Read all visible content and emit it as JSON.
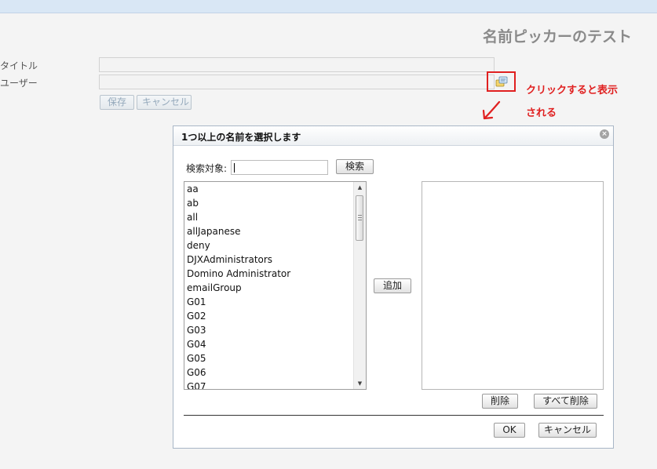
{
  "page": {
    "title": "名前ピッカーのテスト",
    "fields": {
      "title_label": "タイトル",
      "user_label": "ユーザー",
      "title_value": "",
      "user_value": ""
    },
    "buttons": {
      "save": "保存",
      "cancel": "キャンセル"
    },
    "annotation": {
      "line1": "クリックすると表示",
      "line2": "される"
    }
  },
  "dialog": {
    "title": "1つ以上の名前を選択します",
    "close_glyph": "×",
    "search_label": "検索対象:",
    "search_value": "",
    "search_button": "検索",
    "add_button": "追加",
    "delete_button": "削除",
    "delete_all_button": "すべて削除",
    "ok_button": "OK",
    "cancel_button": "キャンセル",
    "names": [
      "aa",
      "ab",
      "all",
      "allJapanese",
      "deny",
      "DJXAdministrators",
      "Domino Administrator",
      "emailGroup",
      "G01",
      "G02",
      "G03",
      "G04",
      "G05",
      "G06",
      "G07"
    ],
    "selected": []
  },
  "icons": {
    "picker": "address-book-icon",
    "close": "close-icon",
    "arrow": "hand-drawn-arrow-icon",
    "scroll_up": "scroll-up-arrow-icon",
    "scroll_down": "scroll-down-arrow-icon"
  },
  "colors": {
    "annotation": "#e02020",
    "title": "#8a8a8a",
    "topbar": "#d9e7f5"
  }
}
